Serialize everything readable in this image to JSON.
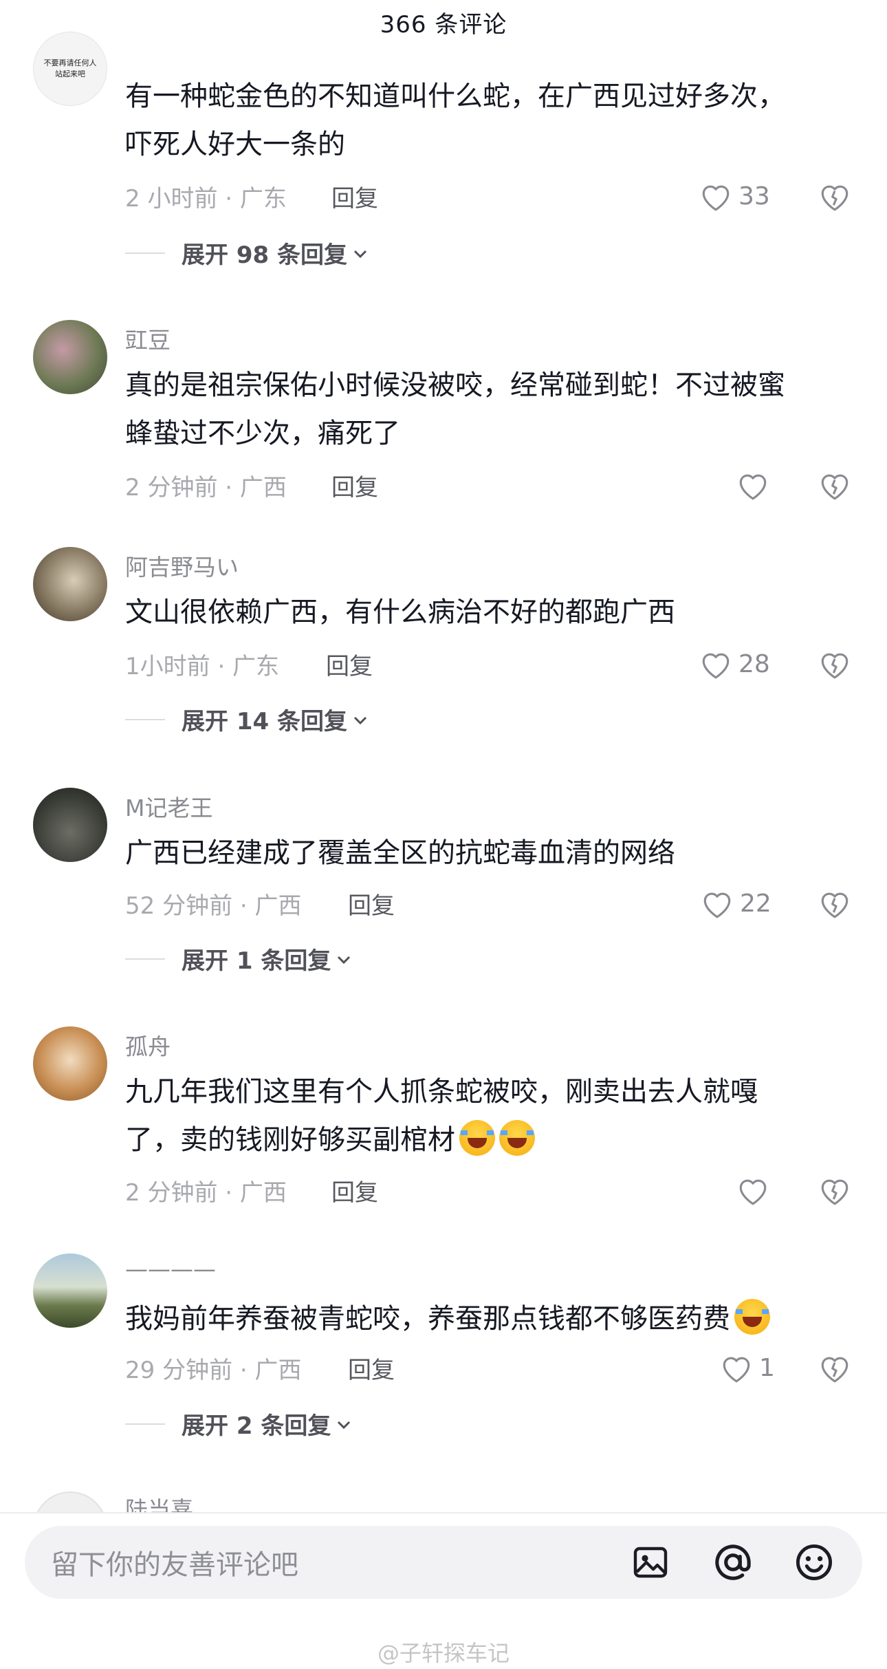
{
  "header": {
    "title": "366 条评论"
  },
  "comments": [
    {
      "username": "",
      "avatar_text": [
        "不要再请任何人",
        "站起来吧"
      ],
      "text_lines": [
        "有一种蛇金色的不知道叫什么蛇，在广西见过好多次，",
        "吓死人好大一条的"
      ],
      "meta": "2 小时前 · 广东",
      "reply": "回复",
      "likes": "33",
      "expand": "展开 98 条回复"
    },
    {
      "username": "豇豆",
      "text_lines": [
        "真的是祖宗保佑小时候没被咬，经常碰到蛇！不过被蜜",
        "蜂蛰过不少次，痛死了"
      ],
      "meta": "2 分钟前 · 广西",
      "reply": "回复",
      "likes": ""
    },
    {
      "username": "阿吉野马い",
      "text_lines": [
        "文山很依赖广西，有什么病治不好的都跑广西"
      ],
      "meta": "1小时前 · 广东",
      "reply": "回复",
      "likes": "28",
      "expand": "展开 14 条回复"
    },
    {
      "username": "M记老王",
      "text_lines": [
        "广西已经建成了覆盖全区的抗蛇毒血清的网络"
      ],
      "meta": "52 分钟前 · 广西",
      "reply": "回复",
      "likes": "22",
      "expand": "展开 1 条回复"
    },
    {
      "username": "孤舟",
      "text_lines": [
        "九几年我们这里有个人抓条蛇被咬，刚卖出去人就嘎",
        "了，卖的钱刚好够买副棺材"
      ],
      "emoji_count": 2,
      "meta": "2 分钟前 · 广西",
      "reply": "回复",
      "likes": ""
    },
    {
      "username": "————",
      "text_lines": [
        "我妈前年养蚕被青蛇咬，养蚕那点钱都不够医药费"
      ],
      "emoji_count": 1,
      "meta": "29 分钟前 · 广西",
      "reply": "回复",
      "likes": "1",
      "expand": "展开 2 条回复"
    },
    {
      "username": "陆当喜"
    }
  ],
  "bottom_bar": {
    "placeholder": "留下你的友善评论吧",
    "icons": [
      "image-icon",
      "at-icon",
      "emoji-icon"
    ]
  },
  "watermark": "@子轩探车记",
  "colors": {
    "text": "#161823",
    "secondary": "#a8a9ae",
    "reply": "#57585e",
    "accent_bg": "#f2f2f4"
  }
}
